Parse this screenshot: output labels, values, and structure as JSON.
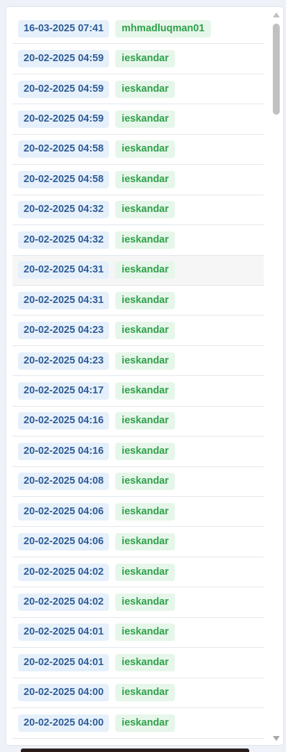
{
  "entries": [
    {
      "date": "16-03-2025 07:41",
      "user": "mhmadluqman01"
    },
    {
      "date": "20-02-2025 04:59",
      "user": "ieskandar"
    },
    {
      "date": "20-02-2025 04:59",
      "user": "ieskandar"
    },
    {
      "date": "20-02-2025 04:59",
      "user": "ieskandar"
    },
    {
      "date": "20-02-2025 04:58",
      "user": "ieskandar"
    },
    {
      "date": "20-02-2025 04:58",
      "user": "ieskandar"
    },
    {
      "date": "20-02-2025 04:32",
      "user": "ieskandar"
    },
    {
      "date": "20-02-2025 04:32",
      "user": "ieskandar"
    },
    {
      "date": "20-02-2025 04:31",
      "user": "ieskandar"
    },
    {
      "date": "20-02-2025 04:31",
      "user": "ieskandar"
    },
    {
      "date": "20-02-2025 04:23",
      "user": "ieskandar"
    },
    {
      "date": "20-02-2025 04:23",
      "user": "ieskandar"
    },
    {
      "date": "20-02-2025 04:17",
      "user": "ieskandar"
    },
    {
      "date": "20-02-2025 04:16",
      "user": "ieskandar"
    },
    {
      "date": "20-02-2025 04:16",
      "user": "ieskandar"
    },
    {
      "date": "20-02-2025 04:08",
      "user": "ieskandar"
    },
    {
      "date": "20-02-2025 04:06",
      "user": "ieskandar"
    },
    {
      "date": "20-02-2025 04:06",
      "user": "ieskandar"
    },
    {
      "date": "20-02-2025 04:02",
      "user": "ieskandar"
    },
    {
      "date": "20-02-2025 04:02",
      "user": "ieskandar"
    },
    {
      "date": "20-02-2025 04:01",
      "user": "ieskandar"
    },
    {
      "date": "20-02-2025 04:01",
      "user": "ieskandar"
    },
    {
      "date": "20-02-2025 04:00",
      "user": "ieskandar"
    },
    {
      "date": "20-02-2025 04:00",
      "user": "ieskandar"
    }
  ],
  "colors": {
    "date_badge_bg": "#e6f0fb",
    "date_badge_text": "#2e5c96",
    "user_badge_bg": "#e7f6ea",
    "user_badge_text": "#2ea14a"
  },
  "icons": {
    "scroll_up": "scroll-up-arrow-icon",
    "scroll_down": "scroll-down-arrow-icon"
  }
}
